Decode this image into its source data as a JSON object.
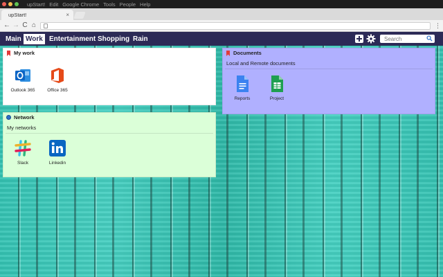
{
  "window": {
    "menu": [
      "upStart!",
      "Edit",
      "Google Chrome",
      "Tools",
      "People",
      "Help"
    ]
  },
  "browser": {
    "tab_title": "upStart!",
    "tab_close": "×",
    "back": "←",
    "forward": "→",
    "reload": "C",
    "home": "⌂",
    "more": "⋮"
  },
  "app": {
    "nav": [
      "Main",
      "Work",
      "Entertainment",
      "Shopping",
      "Rain"
    ],
    "active_nav": "Work",
    "add_icon": "plus-icon",
    "settings_icon": "gear-icon",
    "search_placeholder": "Search"
  },
  "panels": {
    "mywork": {
      "title": "My work",
      "items": [
        {
          "label": "Outlook 365",
          "icon": "outlook-icon",
          "color": "#0a64c4"
        },
        {
          "label": "Office 365",
          "icon": "office-icon",
          "color": "#e64a19"
        }
      ]
    },
    "network": {
      "title": "Network",
      "subtitle": "My networks",
      "items": [
        {
          "label": "Slack",
          "icon": "slack-icon"
        },
        {
          "label": "Linkedin",
          "icon": "linkedin-icon",
          "color": "#0a66c2"
        }
      ]
    },
    "documents": {
      "title": "Documents",
      "subtitle": "Local and Remote documents",
      "items": [
        {
          "label": "Reports",
          "icon": "docs-icon",
          "color": "#3b82f0"
        },
        {
          "label": "Project",
          "icon": "sheets-icon",
          "color": "#1e9f50"
        }
      ]
    }
  },
  "colors": {
    "nav_bg": "#2c2a56",
    "mywork_bg": "#ffffff",
    "network_bg": "#dbffd8",
    "documents_bg": "#b0b0ff",
    "bookmark": "#e23b3b"
  }
}
